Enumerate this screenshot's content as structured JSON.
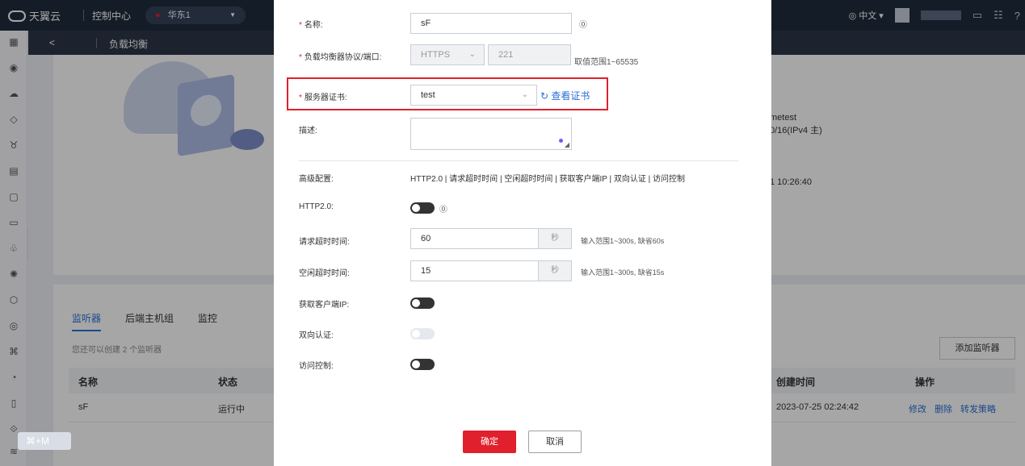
{
  "topbar": {
    "brand": "天翼云",
    "console": "控制中心",
    "region": "华东1",
    "lang": "中文"
  },
  "subheader": {
    "back": "<",
    "title": "负载均衡"
  },
  "background": {
    "right_line1": "metest",
    "right_line2": "0/16(IPv4 主)",
    "right_line3": "1 10:26:40",
    "tabs": [
      "监听器",
      "后端主机组",
      "监控"
    ],
    "hint": "您还可以创建 2 个监听器",
    "add_button": "添加监听器",
    "table": {
      "headers": [
        "名称",
        "状态",
        "创建时间",
        "操作"
      ],
      "row": {
        "name": "sF",
        "status": "运行中",
        "created": "2023-07-25 02:24:42",
        "ops": [
          "修改",
          "删除",
          "转发策略"
        ]
      }
    },
    "shortcut": "⌘+M"
  },
  "modal": {
    "name_label": "名称:",
    "name_value": "sF",
    "protocol_label": "负载均衡器协议/端口:",
    "protocol_value": "HTTPS",
    "port_value": "221",
    "port_range": "取值范围1~65535",
    "cert_label": "服务器证书:",
    "cert_value": "test",
    "view_cert": "查看证书",
    "desc_label": "描述:",
    "advanced_label": "高级配置:",
    "advanced_items": "HTTP2.0 | 请求超时时间 | 空闲超时时间 | 获取客户端IP | 双向认证 | 访问控制",
    "http2_label": "HTTP2.0:",
    "req_timeout_label": "请求超时时间:",
    "req_timeout_value": "60",
    "req_timeout_unit": "秒",
    "req_timeout_tip": "输入范围1~300s, 缺省60s",
    "idle_timeout_label": "空闲超时时间:",
    "idle_timeout_value": "15",
    "idle_timeout_unit": "秒",
    "idle_timeout_tip": "输入范围1~300s, 缺省15s",
    "client_ip_label": "获取客户端IP:",
    "mutual_auth_label": "双向认证:",
    "access_control_label": "访问控制:",
    "confirm": "确定",
    "cancel": "取消"
  }
}
